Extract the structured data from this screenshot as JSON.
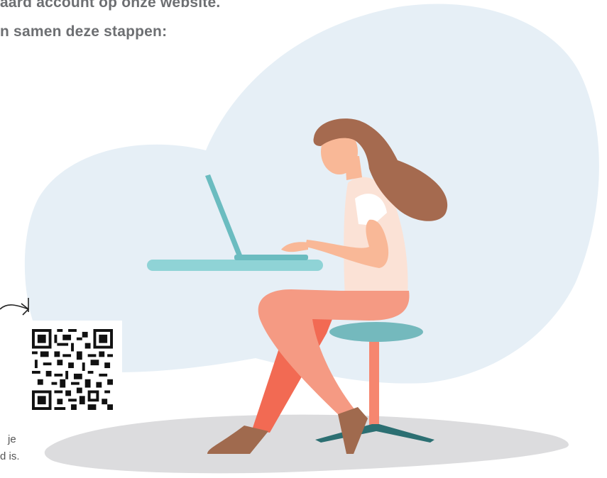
{
  "headline": {
    "line1": "aard account op onze website.",
    "line2": "n samen deze stappen:"
  },
  "caption": {
    "line1": " je",
    "line2": "d is."
  },
  "illustration": {
    "blob_color": "#e6eff6",
    "floor_color": "#dcdcde",
    "desk_color": "#8fd3d6",
    "laptop_color": "#6bbcc0",
    "stool_seat_color": "#74b9bd",
    "stool_base_color": "#2c6f72",
    "hair_color": "#a56a4f",
    "skin_color": "#f9b897",
    "shirt_color": "#fbe2d6",
    "pants_color": "#f6866f",
    "shoe_color": "#a06a4e"
  },
  "icons": {
    "arrow": "curved-arrow-icon",
    "qr": "qr-code-icon"
  }
}
